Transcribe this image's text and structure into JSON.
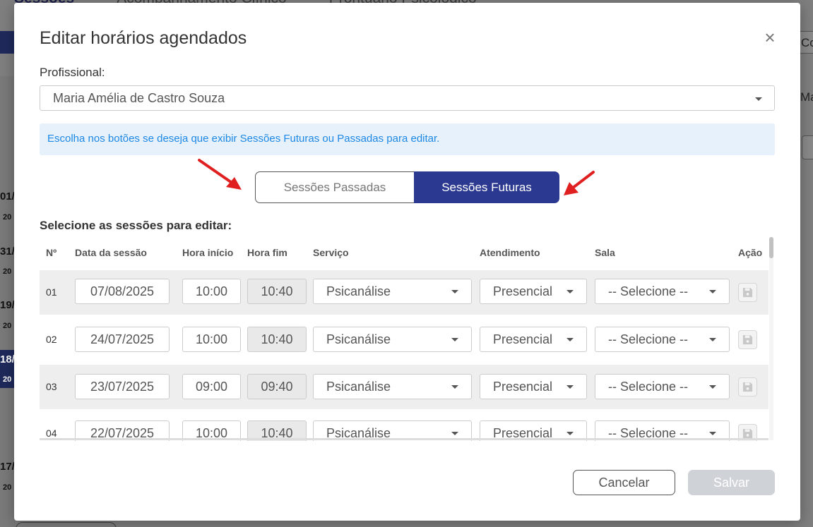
{
  "background": {
    "tabs": [
      "Sessões",
      "Acompanhamento Clínico",
      "Prontuário Psicológico"
    ],
    "left_dates": [
      {
        "day": "01/",
        "year": "20"
      },
      {
        "day": "31/",
        "year": "20"
      },
      {
        "day": "19/",
        "year": "20"
      },
      {
        "day": "18/",
        "year": "20"
      },
      {
        "day": "17/",
        "year": "20"
      }
    ],
    "right_button": "Corre",
    "right_text": "Ma"
  },
  "modal": {
    "title": "Editar horários agendados",
    "close": "×",
    "professional": {
      "label": "Profissional:",
      "value": "Maria Amélia de Castro Souza"
    },
    "info": "Escolha nos botões se deseja que exibir Sessões Futuras ou Passadas para editar.",
    "toggle": {
      "past": "Sessões Passadas",
      "future": "Sessões Futuras",
      "active": "future"
    },
    "section_label": "Selecione as sessões para editar:",
    "table": {
      "headers": {
        "num": "Nº",
        "date": "Data da sessão",
        "start": "Hora início",
        "end": "Hora fim",
        "service": "Serviço",
        "attendance": "Atendimento",
        "room": "Sala",
        "action": "Ação"
      },
      "rows": [
        {
          "num": "01",
          "date": "07/08/2025",
          "start": "10:00",
          "end": "10:40",
          "service": "Psicanálise",
          "attendance": "Presencial",
          "room": "-- Selecione --"
        },
        {
          "num": "02",
          "date": "24/07/2025",
          "start": "10:00",
          "end": "10:40",
          "service": "Psicanálise",
          "attendance": "Presencial",
          "room": "-- Selecione --"
        },
        {
          "num": "03",
          "date": "23/07/2025",
          "start": "09:00",
          "end": "09:40",
          "service": "Psicanálise",
          "attendance": "Presencial",
          "room": "-- Selecione --"
        },
        {
          "num": "04",
          "date": "22/07/2025",
          "start": "10:00",
          "end": "10:40",
          "service": "Psicanálise",
          "attendance": "Presencial",
          "room": "-- Selecione --"
        }
      ]
    },
    "buttons": {
      "cancel": "Cancelar",
      "save": "Salvar"
    }
  },
  "colors": {
    "primary": "#2b3990",
    "info_bg": "#e6f1fb",
    "info_text": "#1e88e5",
    "arrow": "#e02020",
    "save_disabled": "#cfd3d8"
  }
}
